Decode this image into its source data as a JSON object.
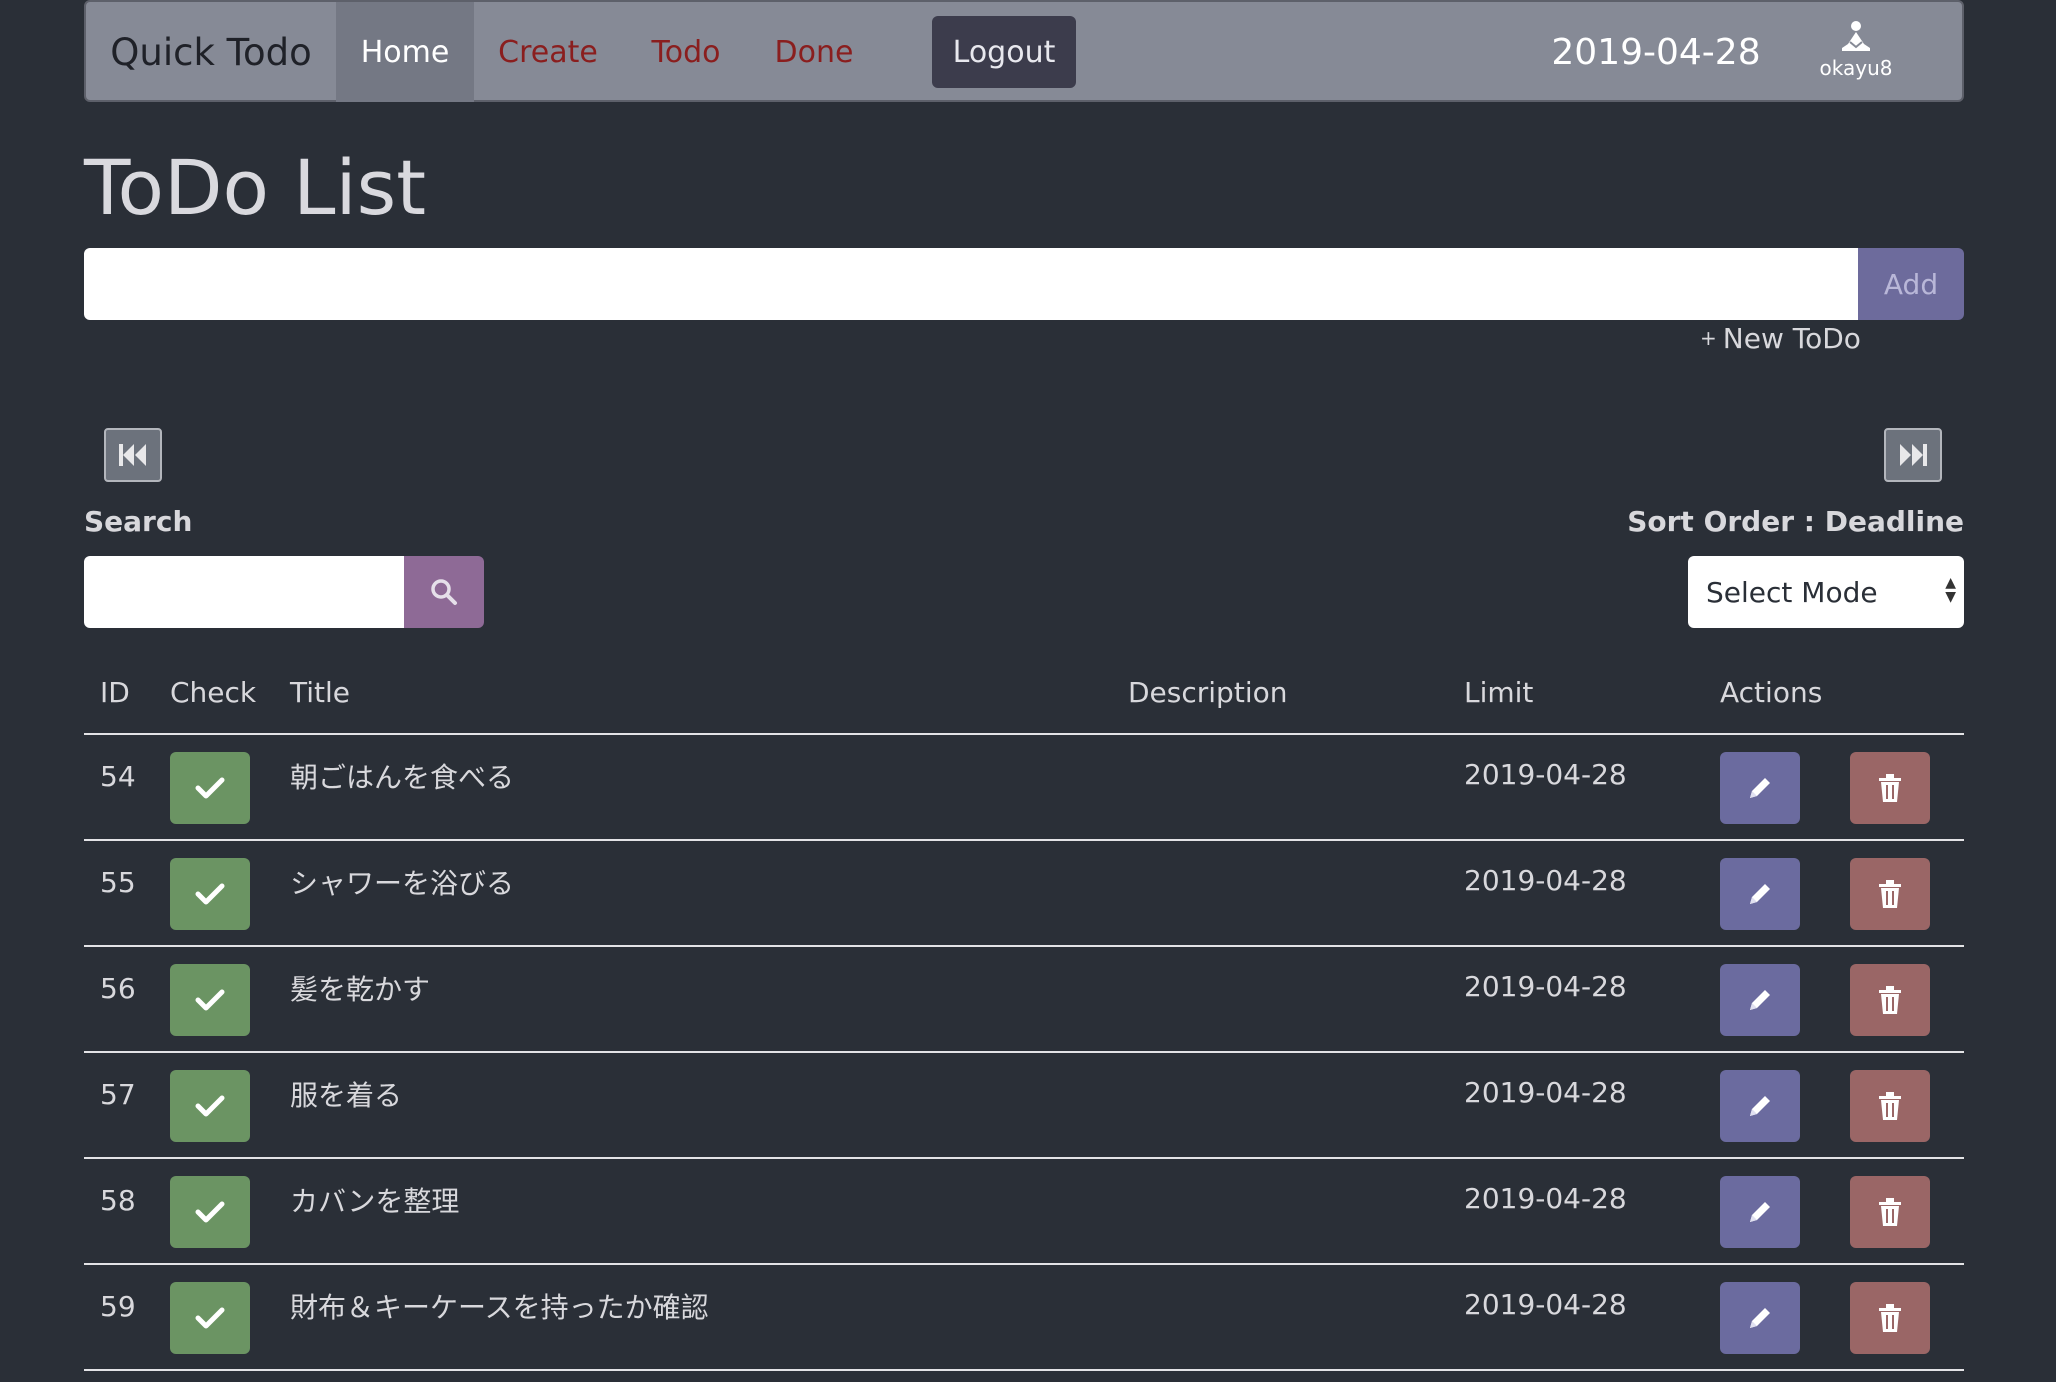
{
  "nav": {
    "brand": "Quick Todo",
    "items": [
      {
        "label": "Home"
      },
      {
        "label": "Create"
      },
      {
        "label": "Todo"
      },
      {
        "label": "Done"
      }
    ],
    "logout": "Logout",
    "date": "2019-04-28",
    "user": "okayu8",
    "user_icon": "meditating-person-icon"
  },
  "page": {
    "title": "ToDo List",
    "add_input_value": "",
    "add_button": "Add",
    "new_todo": "New ToDo",
    "new_todo_prefix": "+"
  },
  "search": {
    "label": "Search",
    "value": "",
    "icon": "search-icon"
  },
  "sort": {
    "label": "Sort Order : Deadline",
    "selected": "Select Mode"
  },
  "table": {
    "headers": [
      "ID",
      "Check",
      "Title",
      "Description",
      "Limit",
      "Actions"
    ],
    "rows": [
      {
        "id": "54",
        "title": "朝ごはんを食べる",
        "description": "",
        "limit": "2019-04-28"
      },
      {
        "id": "55",
        "title": "シャワーを浴びる",
        "description": "",
        "limit": "2019-04-28"
      },
      {
        "id": "56",
        "title": "髪を乾かす",
        "description": "",
        "limit": "2019-04-28"
      },
      {
        "id": "57",
        "title": "服を着る",
        "description": "",
        "limit": "2019-04-28"
      },
      {
        "id": "58",
        "title": "カバンを整理",
        "description": "",
        "limit": "2019-04-28"
      },
      {
        "id": "59",
        "title": "財布＆キーケースを持ったか確認",
        "description": "",
        "limit": "2019-04-28"
      }
    ]
  },
  "colors": {
    "background": "#2a2f37",
    "navbar": "#868a96",
    "check": "#6b9463",
    "edit": "#6b6b9f",
    "delete": "#9a6666",
    "search_button": "#8e6a96",
    "add_button": "#6d6b9c",
    "nav_link": "#8a1e1e"
  }
}
